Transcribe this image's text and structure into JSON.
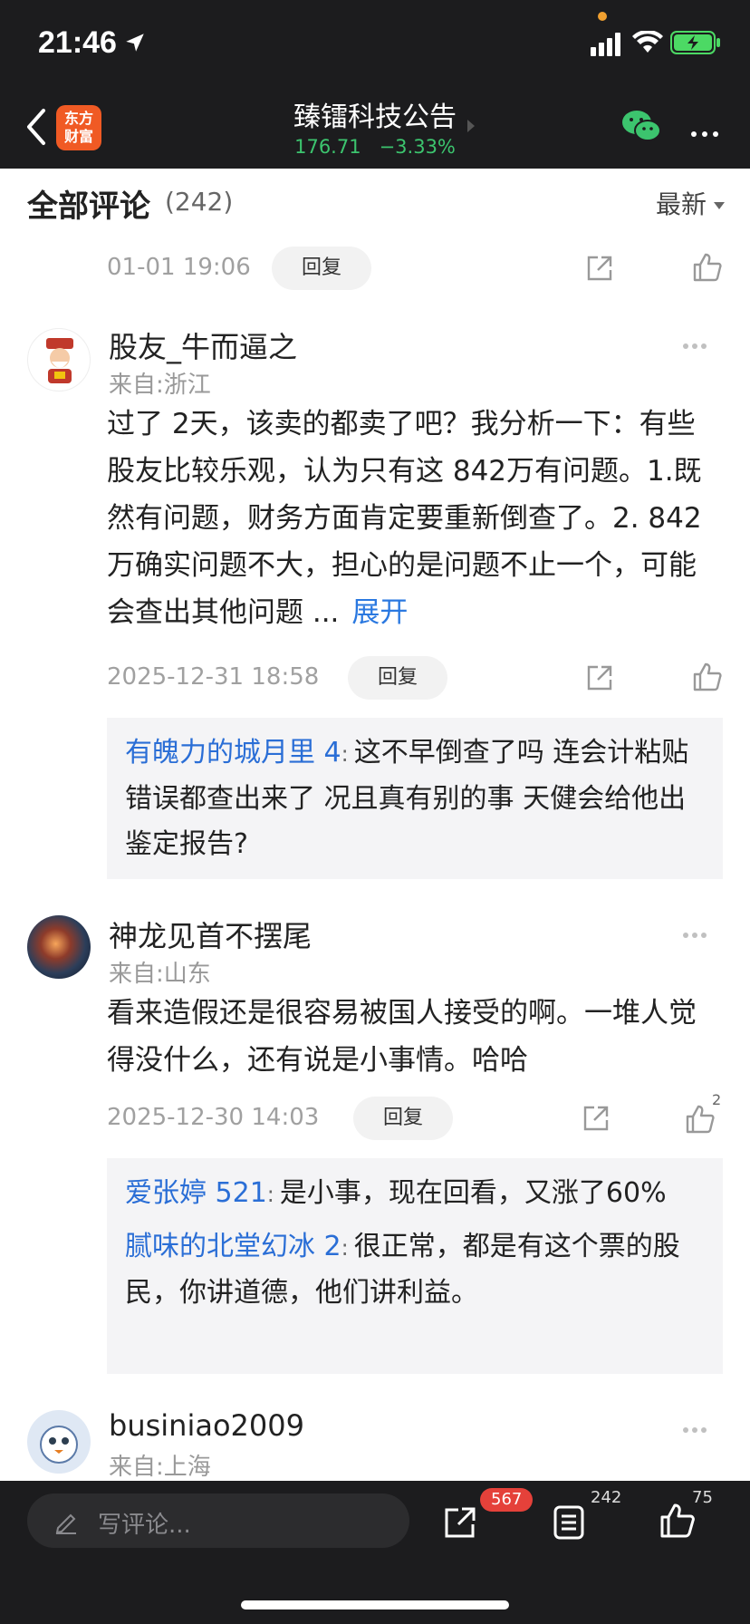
{
  "status_bar": {
    "time": "21:46"
  },
  "nav": {
    "logo_line1": "东方",
    "logo_line2": "财富",
    "title": "臻镭科技公告",
    "price": "176.71",
    "change": "−3.33%"
  },
  "header": {
    "title": "全部评论",
    "count": "(242)",
    "sort_label": "最新"
  },
  "comments": [
    {
      "time": "01-01 19:06",
      "reply_label": "回复"
    },
    {
      "username": "股友_牛而逼之",
      "location": "来自:浙江",
      "text": "过了 2天，该卖的都卖了吧？我分析一下：有些股友比较乐观，认为只有这 842万有问题。1.既然有问题，财务方面肯定要重新倒查了。2. 842万确实问题不大，担心的是问题不止一个，可能会查出其他问题 ...",
      "expand_label": "展开",
      "time": "2025-12-31 18:58",
      "reply_label": "回复",
      "replies": [
        {
          "name": "有魄力的城月里 4",
          "text": "这不早倒查了吗 连会计粘贴错误都查出来了 况且真有别的事 天健会给他出鉴定报告?"
        }
      ]
    },
    {
      "username": "神龙见首不摆尾",
      "location": "来自:山东",
      "text": "看来造假还是很容易被国人接受的啊。一堆人觉得没什么，还有说是小事情。哈哈",
      "time": "2025-12-30 14:03",
      "reply_label": "回复",
      "like_count": "2",
      "replies": [
        {
          "name": "爱张婷 521",
          "text": "是小事，现在回看，又涨了60%"
        },
        {
          "name": "腻味的北堂幻冰 2",
          "text": "很正常，都是有这个票的股民，你讲道德，他们讲利益。"
        }
      ]
    },
    {
      "username": "businiao2009",
      "location": "来自:上海"
    }
  ],
  "bottom_bar": {
    "input_placeholder": "写评论...",
    "share_count": "567",
    "comment_count": "242",
    "like_count": "75"
  }
}
